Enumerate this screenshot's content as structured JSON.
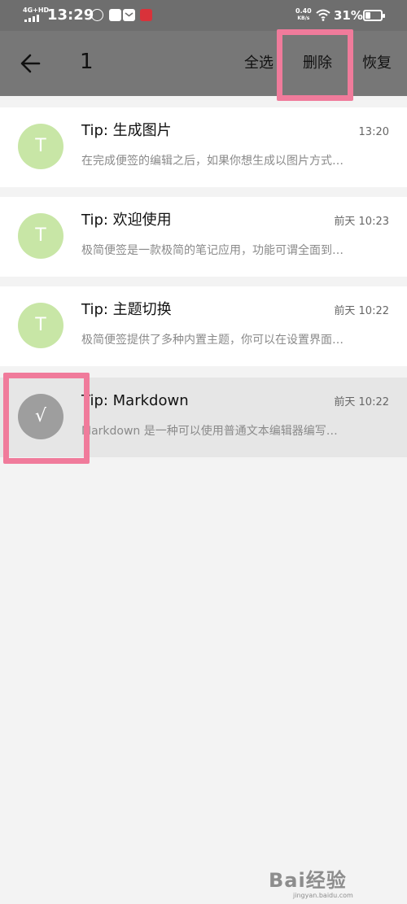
{
  "status_bar": {
    "network": "4G+HD",
    "time": "13:29",
    "net_speed_value": "0.40",
    "net_speed_unit": "KB/s",
    "battery": "31%",
    "battery_level": 0.31
  },
  "action_bar": {
    "selected_count": "1",
    "select_all_label": "全选",
    "delete_label": "删除",
    "restore_label": "恢复"
  },
  "notes": [
    {
      "avatar_letter": "T",
      "title": "Tip: 生成图片",
      "time": "13:20",
      "preview": "在完成便签的编辑之后，如果你想生成以图片方式…",
      "selected": false
    },
    {
      "avatar_letter": "T",
      "title": "Tip: 欢迎使用",
      "time": "前天 10:23",
      "preview": "极简便签是一款极简的笔记应用，功能可谓全面到…",
      "selected": false
    },
    {
      "avatar_letter": "T",
      "title": "Tip: 主题切换",
      "time": "前天 10:22",
      "preview": "极简便签提供了多种内置主题，你可以在设置界面…",
      "selected": false
    },
    {
      "avatar_letter": "√",
      "title": "Tip: Markdown",
      "time": "前天 10:22",
      "preview": "Markdown 是一种可以使用普通文本编辑器编写…",
      "selected": true
    }
  ],
  "colors": {
    "highlight": "#f07b9b",
    "avatar_green": "#c8e6a6",
    "avatar_checked": "#9e9e9e",
    "action_bar": "#777777"
  },
  "icons": {
    "back": "arrow-left-icon",
    "wifi": "wifi-icon",
    "battery": "battery-icon",
    "check": "checkmark-icon"
  },
  "watermark": {
    "text": "Bai经验",
    "sub": "jingyan.baidu.com"
  }
}
